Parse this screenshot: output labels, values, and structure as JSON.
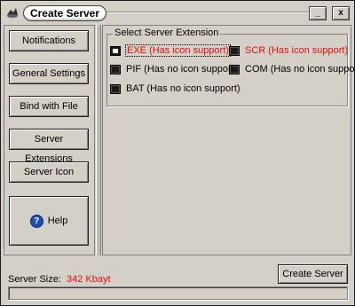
{
  "window": {
    "title": "Create Server",
    "minimize_glyph": "_",
    "close_glyph": "x"
  },
  "sidebar": {
    "items": [
      {
        "label": "Notifications"
      },
      {
        "label": "General Settings"
      },
      {
        "label": "Bind with File"
      },
      {
        "label": "Server Extensions"
      },
      {
        "label": "Server Icon"
      }
    ],
    "help": {
      "label": "Help",
      "icon": "help-icon",
      "icon_glyph": "?"
    }
  },
  "extensions": {
    "legend": "Select Server Extension",
    "selected": "EXE",
    "options": [
      {
        "label": "EXE (Has icon support)",
        "color": "#e01010"
      },
      {
        "label": "SCR (Has icon support)",
        "color": "#e01010"
      },
      {
        "label": "PIF (Has no icon support)",
        "color": "#000000"
      },
      {
        "label": "COM (Has no icon support)",
        "color": "#000000"
      },
      {
        "label": "BAT (Has no icon support)",
        "color": "#000000"
      }
    ]
  },
  "status": {
    "size_label": "Server Size:",
    "size_value": "342 Kbayt",
    "progress": 0
  },
  "actions": {
    "create_label": "Create Server"
  }
}
